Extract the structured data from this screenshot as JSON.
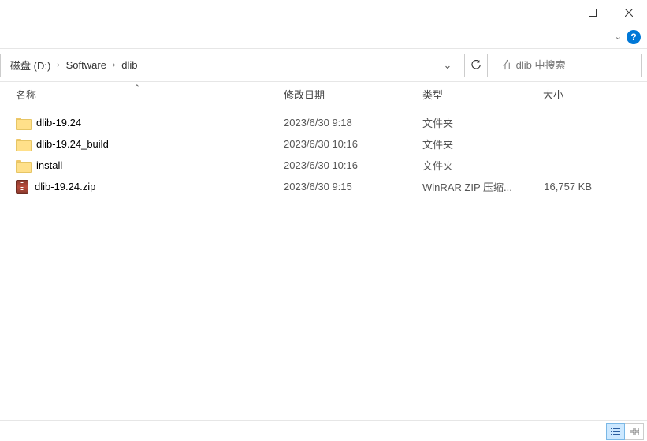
{
  "window": {
    "help_tooltip": "?"
  },
  "breadcrumb": {
    "segments": [
      "磁盘 (D:)",
      "Software",
      "dlib"
    ]
  },
  "search": {
    "placeholder": "在 dlib 中搜索"
  },
  "columns": {
    "name": "名称",
    "modified": "修改日期",
    "type": "类型",
    "size": "大小"
  },
  "items": [
    {
      "icon": "folder",
      "name": "dlib-19.24",
      "modified": "2023/6/30 9:18",
      "type": "文件夹",
      "size": ""
    },
    {
      "icon": "folder",
      "name": "dlib-19.24_build",
      "modified": "2023/6/30 10:16",
      "type": "文件夹",
      "size": ""
    },
    {
      "icon": "folder",
      "name": "install",
      "modified": "2023/6/30 10:16",
      "type": "文件夹",
      "size": ""
    },
    {
      "icon": "zip",
      "name": "dlib-19.24.zip",
      "modified": "2023/6/30 9:15",
      "type": "WinRAR ZIP 压缩...",
      "size": "16,757 KB"
    }
  ]
}
